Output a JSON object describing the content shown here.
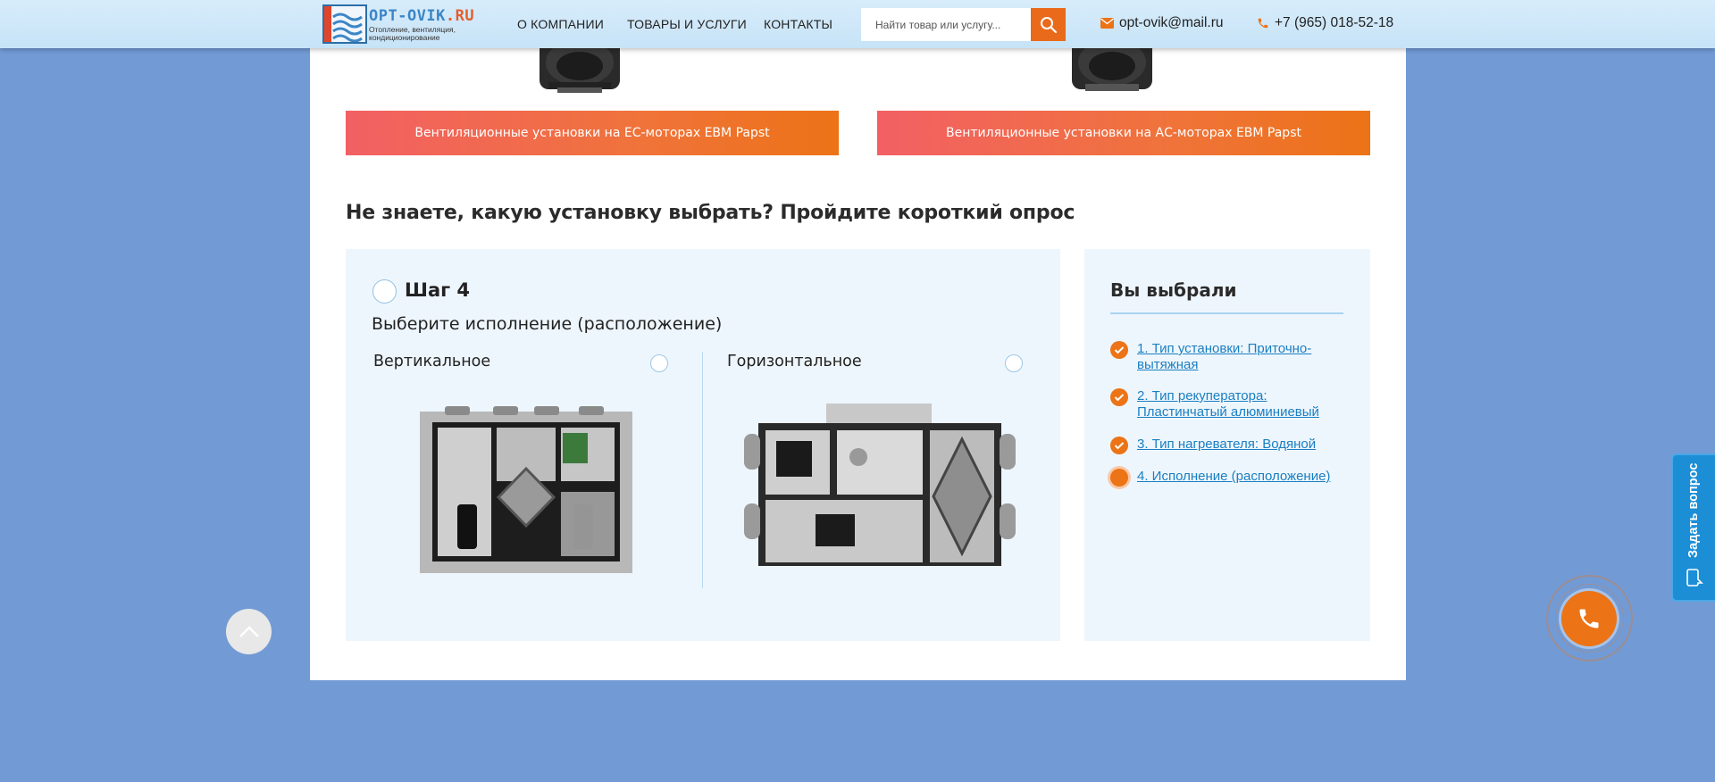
{
  "header": {
    "logo": {
      "title_main": "OPT-OVIK",
      "title_tld": ".RU",
      "subtitle": "Отопление, вентиляция, кондиционирование"
    },
    "nav": [
      "О КОМПАНИИ",
      "ТОВАРЫ И УСЛУГИ",
      "КОНТАКТЫ"
    ],
    "search": {
      "placeholder": "Найти товар или услугу..."
    },
    "email": "opt-ovik@mail.ru",
    "phone": "+7 (965) 018-52-18"
  },
  "categories": [
    {
      "label": "Вентиляционные установки на ЕС-моторах EBM Papst"
    },
    {
      "label": "Вентиляционные установки на АС-моторах EBM Papst"
    }
  ],
  "quiz": {
    "title": "Не знаете, какую установку выбрать?  Пройдите короткий опрос",
    "step_title": "Шаг 4",
    "question": "Выберите исполнение (расположение)",
    "options": [
      {
        "label": "Вертикальное",
        "selected": false
      },
      {
        "label": "Горизонтальное",
        "selected": false
      }
    ]
  },
  "summary": {
    "title": "Вы выбрали",
    "items": [
      {
        "text": "1. Тип установки: Приточно-вытяжная",
        "state": "done"
      },
      {
        "text": "2. Тип рекуператора: Пластинчатый алюминиевый",
        "state": "done"
      },
      {
        "text": "3. Тип нагревателя: Водяной",
        "state": "done"
      },
      {
        "text": "4. Исполнение (расположение)",
        "state": "current"
      }
    ]
  },
  "widgets": {
    "ask_question": "Задать вопрос"
  },
  "colors": {
    "accent": "#ec7316",
    "page_bg": "#729bd5",
    "link": "#1a7fc1",
    "quiz_bg": "#eef6fd"
  }
}
